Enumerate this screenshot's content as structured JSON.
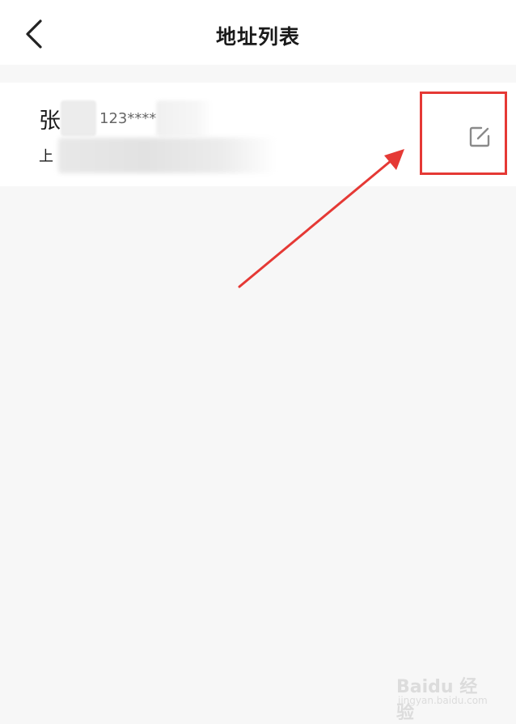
{
  "header": {
    "title": "地址列表",
    "back_icon": "chevron-left-icon"
  },
  "address": {
    "name_visible": "张",
    "phone_visible": "123****",
    "address_visible": "上",
    "edit_icon": "edit-icon"
  },
  "annotation": {
    "box_color": "#e53935",
    "arrow_color": "#e53935"
  },
  "watermark": {
    "brand": "Baidu 经验",
    "url": "jingyan.baidu.com"
  }
}
